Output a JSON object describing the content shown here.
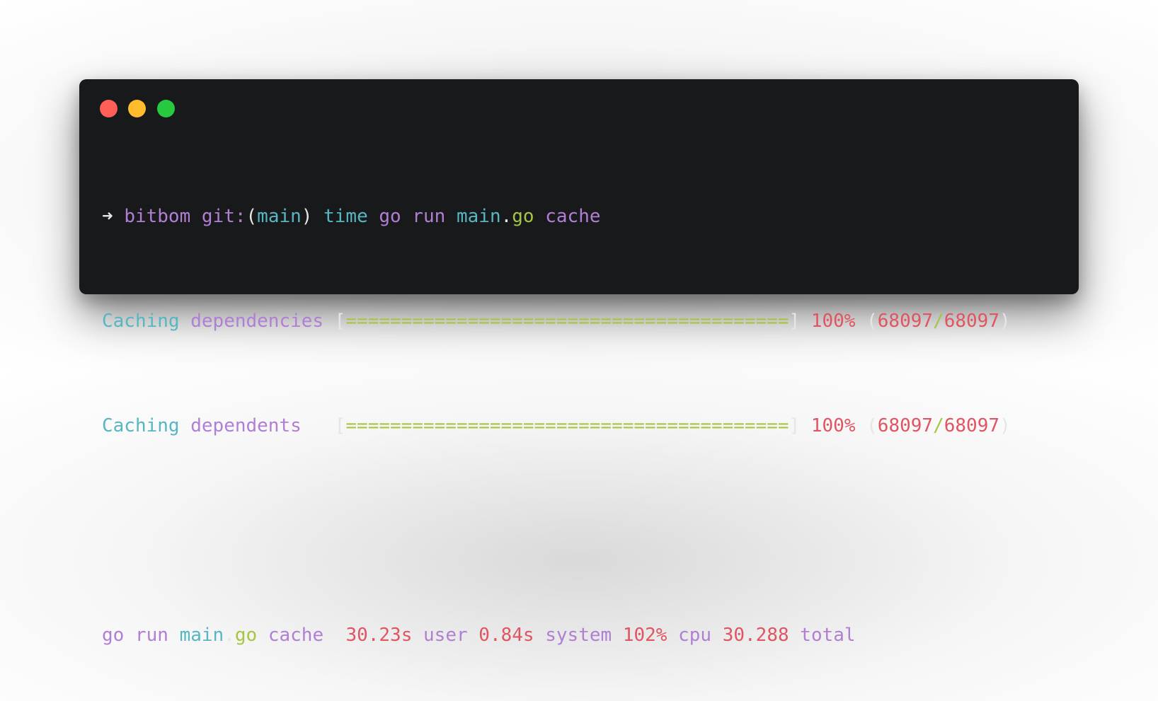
{
  "window": {
    "buttons": {
      "close": "close",
      "minimize": "minimize",
      "zoom": "zoom"
    }
  },
  "prompt": {
    "arrow": "➜",
    "dir": "bitbom",
    "git_label": "git:",
    "branch": "main",
    "command": {
      "cmd1": "time",
      "cmd2": "go",
      "cmd3": "run",
      "file_base": "main",
      "file_ext": "go",
      "arg": "cache"
    }
  },
  "progress": [
    {
      "word1": "Caching",
      "word2": "dependencies",
      "pad": " ",
      "bar": "========================================",
      "fraction": 1.0,
      "percent": "100%",
      "current": "68097",
      "total": "68097"
    },
    {
      "word1": "Caching",
      "word2": "dependents",
      "pad": "   ",
      "bar": "========================================",
      "fraction": 1.0,
      "percent": "100%",
      "current": "68097",
      "total": "68097"
    }
  ],
  "timing": {
    "cmd": {
      "w1": "go",
      "w2": "run",
      "file_base": "main",
      "file_ext": "go",
      "arg": "cache"
    },
    "user_time": "30.23s",
    "user_label": "user",
    "system_time": "0.84s",
    "system_label": "system",
    "cpu_pct": "102%",
    "cpu_label": "cpu",
    "total_time": "30.288",
    "total_label": "total"
  },
  "colors": {
    "background": "#18191b",
    "cyan": "#56b6c2",
    "purple": "#b07fd3",
    "lime": "#a6c543",
    "red": "#e05561",
    "white": "#e6e6e6"
  }
}
